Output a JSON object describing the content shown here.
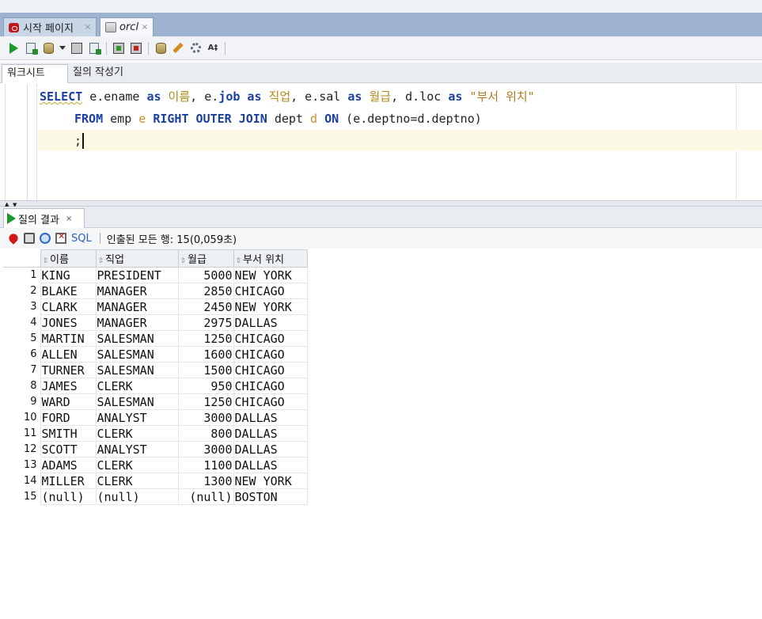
{
  "tabs": [
    {
      "label": "시작 페이지",
      "close": "×"
    },
    {
      "label": "orcl",
      "close": "×"
    }
  ],
  "editor_tabs": {
    "worksheet": "워크시트",
    "query_builder": "질의 작성기"
  },
  "sql": {
    "line1": {
      "select": "SELECT",
      "p1": " e.ename ",
      "as1": "as",
      "a1": " 이름",
      "p2": ", e.",
      "job": "job",
      "p3": " ",
      "as2": "as",
      "a2": " 직업",
      "p4": ", e.sal ",
      "as3": "as",
      "a3": " 월급",
      "p5": ", d.loc ",
      "as4": "as",
      "a4": " \"부서 위치\""
    },
    "line2": {
      "from": "FROM",
      "p1": " emp ",
      "e": "e",
      "p2": " ",
      "join": "RIGHT OUTER JOIN",
      "p3": " dept ",
      "d": "d",
      "p4": " ",
      "on": "ON",
      "p5": " (e.deptno=d.deptno)"
    },
    "line3": ";"
  },
  "result_tab": {
    "label": "질의 결과",
    "close": "×"
  },
  "result_toolbar": {
    "sql_link": "SQL",
    "status": "인출된 모든 행: 15(0,059초)"
  },
  "columns": [
    "이름",
    "직업",
    "월급",
    "부서 위치"
  ],
  "rows": [
    {
      "n": "1",
      "name": "KING",
      "job": "PRESIDENT",
      "sal": "5000",
      "loc": "NEW YORK"
    },
    {
      "n": "2",
      "name": "BLAKE",
      "job": "MANAGER",
      "sal": "2850",
      "loc": "CHICAGO"
    },
    {
      "n": "3",
      "name": "CLARK",
      "job": "MANAGER",
      "sal": "2450",
      "loc": "NEW YORK"
    },
    {
      "n": "4",
      "name": "JONES",
      "job": "MANAGER",
      "sal": "2975",
      "loc": "DALLAS"
    },
    {
      "n": "5",
      "name": "MARTIN",
      "job": "SALESMAN",
      "sal": "1250",
      "loc": "CHICAGO"
    },
    {
      "n": "6",
      "name": "ALLEN",
      "job": "SALESMAN",
      "sal": "1600",
      "loc": "CHICAGO"
    },
    {
      "n": "7",
      "name": "TURNER",
      "job": "SALESMAN",
      "sal": "1500",
      "loc": "CHICAGO"
    },
    {
      "n": "8",
      "name": "JAMES",
      "job": "CLERK",
      "sal": "950",
      "loc": "CHICAGO"
    },
    {
      "n": "9",
      "name": "WARD",
      "job": "SALESMAN",
      "sal": "1250",
      "loc": "CHICAGO"
    },
    {
      "n": "10",
      "name": "FORD",
      "job": "ANALYST",
      "sal": "3000",
      "loc": "DALLAS"
    },
    {
      "n": "11",
      "name": "SMITH",
      "job": "CLERK",
      "sal": "800",
      "loc": "DALLAS"
    },
    {
      "n": "12",
      "name": "SCOTT",
      "job": "ANALYST",
      "sal": "3000",
      "loc": "DALLAS"
    },
    {
      "n": "13",
      "name": "ADAMS",
      "job": "CLERK",
      "sal": "1100",
      "loc": "DALLAS"
    },
    {
      "n": "14",
      "name": "MILLER",
      "job": "CLERK",
      "sal": "1300",
      "loc": "NEW YORK"
    },
    {
      "n": "15",
      "name": "(null)",
      "job": "(null)",
      "sal": "(null)",
      "loc": "BOSTON"
    }
  ],
  "icons": {
    "start_tab": "oracle-logo-icon",
    "orcl_tab": "sql-database-icon",
    "toolbar": [
      "run-statement-icon",
      "run-script-icon",
      "autotrace-icon",
      "explain-plan-icon",
      "sql-tuning-icon",
      "commit-icon",
      "rollback-icon",
      "sql-tuning-advisor-icon",
      "clear-icon",
      "history-icon",
      "format-icon"
    ],
    "result_toolbar": [
      "pin-icon",
      "print-icon",
      "refresh-icon",
      "clear-icon"
    ]
  },
  "colors": {
    "keyword": "#1a3fa0",
    "alias": "#b08a1a",
    "tabbar": "#9db3cf",
    "current_line": "#fbf9e4",
    "sql_link": "#2a62b8"
  }
}
